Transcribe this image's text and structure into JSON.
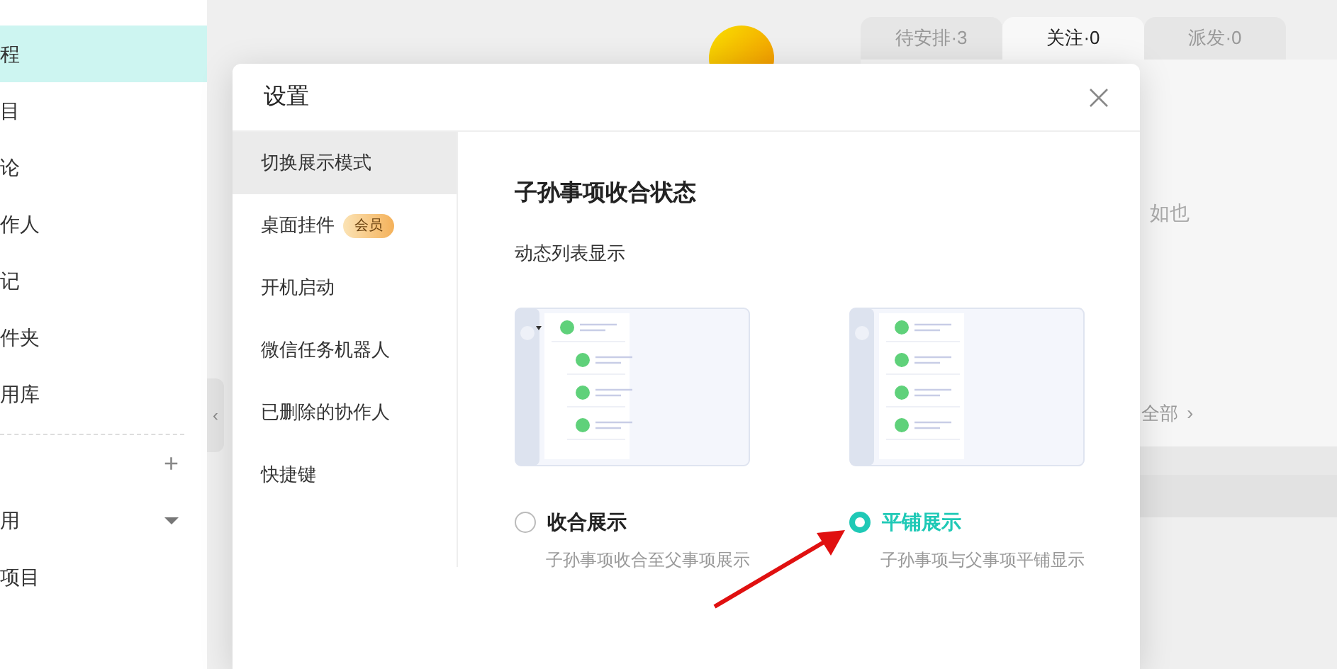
{
  "sidebar": {
    "items": [
      {
        "label": "程",
        "selected": true
      },
      {
        "label": "目",
        "selected": false
      },
      {
        "label": "论",
        "selected": false
      },
      {
        "label": "作人",
        "selected": false
      },
      {
        "label": "记",
        "selected": false
      },
      {
        "label": "件夹",
        "selected": false
      },
      {
        "label": "用库",
        "selected": false
      }
    ],
    "sections": [
      {
        "kind": "add",
        "icon": "+"
      },
      {
        "kind": "group",
        "label": "用",
        "expandable": true
      },
      {
        "kind": "group",
        "label": "项目"
      }
    ]
  },
  "main": {
    "handle_icon": "‹",
    "view_all_icon": "›",
    "tabs": [
      {
        "label": "待安排·3",
        "selected": false
      },
      {
        "label": "关注·0",
        "selected": true
      },
      {
        "label": "派发·0",
        "selected": false
      }
    ],
    "empty_text": "如也",
    "view_all": "全部"
  },
  "dialog": {
    "title": "设置",
    "nav": [
      {
        "label": "切换展示模式",
        "selected": true
      },
      {
        "label": "桌面挂件",
        "badge": "会员",
        "selected": false
      },
      {
        "label": "开机启动",
        "selected": false
      },
      {
        "label": "微信任务机器人",
        "selected": false
      },
      {
        "label": "已删除的协作人",
        "selected": false
      },
      {
        "label": "快捷键",
        "selected": false
      }
    ],
    "heading": "子孙事项收合状态",
    "subheading": "动态列表显示",
    "options": [
      {
        "kind": "collapsed",
        "label": "收合展示",
        "description": "子孙事项收合至父事项展示",
        "selected": false
      },
      {
        "kind": "flat",
        "label": "平铺展示",
        "description": "子孙事项与父事项平铺显示",
        "selected": true
      }
    ]
  }
}
